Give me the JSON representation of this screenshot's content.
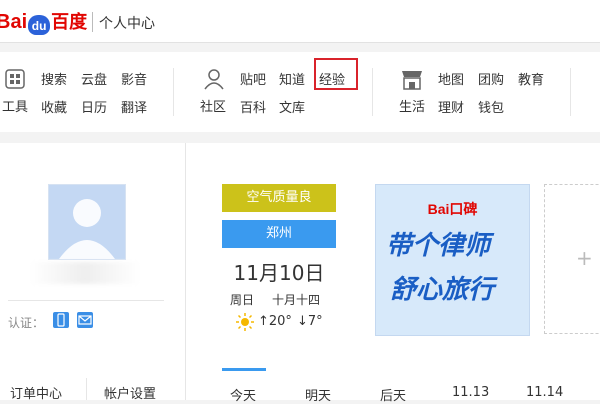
{
  "header": {
    "logo_bai": "Bai",
    "logo_du": "du",
    "logo_cn": "百度",
    "title": "个人中心"
  },
  "nav": {
    "groups": [
      {
        "icon": "grid-icon",
        "icon_label": "工具",
        "links": [
          "搜索",
          "云盘",
          "影音",
          "收藏",
          "日历",
          "翻译"
        ]
      },
      {
        "icon": "people-icon",
        "icon_label": "社区",
        "links": [
          "贴吧",
          "知道",
          "经验",
          "百科",
          "文库"
        ]
      },
      {
        "icon": "store-icon",
        "icon_label": "生活",
        "links": [
          "地图",
          "团购",
          "教育",
          "理财",
          "钱包"
        ]
      }
    ],
    "highlighted": "经验"
  },
  "profile": {
    "verify_label": "认证：",
    "order_center": "订单中心",
    "account_settings": "帐户设置"
  },
  "weather": {
    "air_quality": "空气质量良",
    "city": "郑州",
    "date": "11月10日",
    "weekday": "周日",
    "lunar": "十月十四",
    "high": "↑20°",
    "low": "↓7°"
  },
  "ad": {
    "brand": "Bai口碑",
    "line1": "带个律师",
    "line2": "舒心旅行"
  },
  "day_tabs": [
    "今天",
    "明天",
    "后天",
    "11.13",
    "11.14"
  ],
  "colors": {
    "brand_red": "#e10602",
    "brand_blue": "#2b62d9",
    "air_yellow": "#ccc21a",
    "city_blue": "#3a9aef",
    "highlight_red": "#d9232b"
  }
}
